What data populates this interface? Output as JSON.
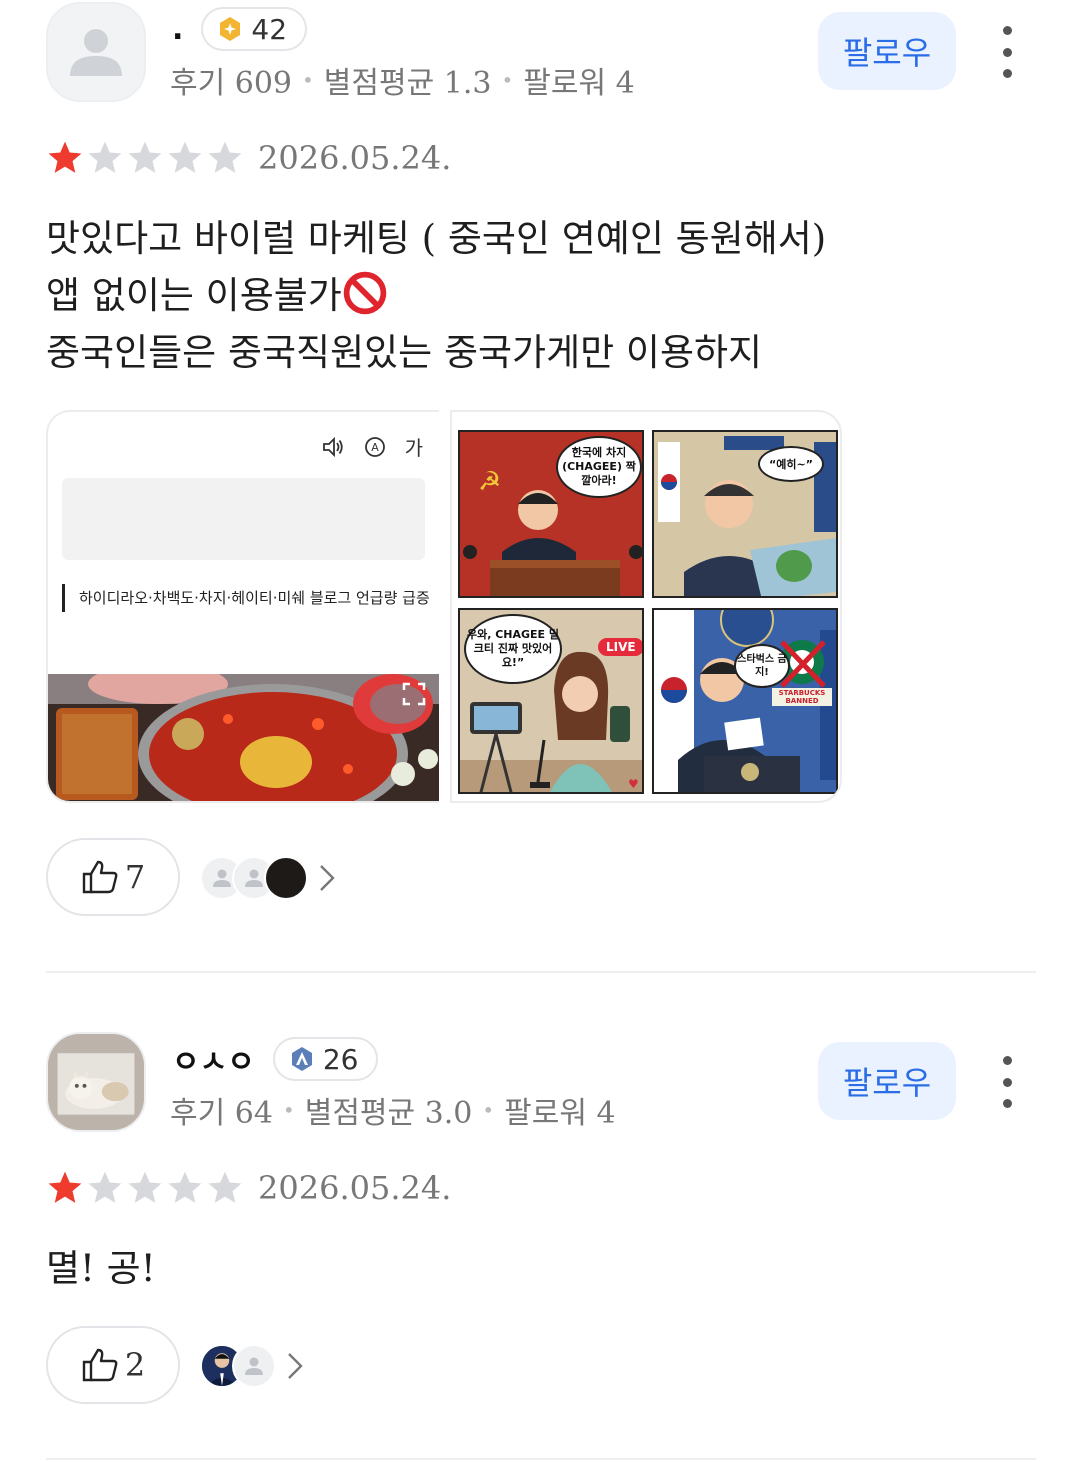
{
  "reviews": [
    {
      "username": ".",
      "level": "42",
      "reviews_label": "후기 609",
      "avg_label": "별점평균 1.3",
      "followers_label": "팔로워 4",
      "follow_label": "팔로우",
      "rating": 1,
      "date": "2026.05.24.",
      "text_lines": [
        "맛있다고 바이럴 마케팅 ( 중국인 연예인 동원해서)",
        "앱 없이는 이용불가",
        "중국인들은 중국직원있는 중국가게만 이용하지"
      ],
      "article": {
        "font_icon": "가",
        "headline": "하이디라오·차백도·차지·헤이티·미쉐 블로그 언급량 급증"
      },
      "comic": {
        "bubble1": "한국에 차지(CHAGEE) 짝 깔아라!",
        "bubble2": "“예히~”",
        "bubble3": "우와, CHAGEE 밀크티 진짜 맛있어요!”",
        "live": "LIVE",
        "bubble4": "스타벅스 금지!",
        "banned": "STARBUCKS BANNED"
      },
      "likes": "7"
    },
    {
      "username": "ㅇㅅㅇ",
      "level": "26",
      "reviews_label": "후기 64",
      "avg_label": "별점평균 3.0",
      "followers_label": "팔로워 4",
      "follow_label": "팔로우",
      "rating": 1,
      "date": "2026.05.24.",
      "text_lines": [
        "멸! 공!"
      ],
      "likes": "2"
    }
  ],
  "colors": {
    "accent_blue": "#2a6de6",
    "follow_bg": "#eaf2ff",
    "star_filled": "#ee3b2e",
    "star_empty": "#d6d8db",
    "meta_gray": "#777777"
  }
}
